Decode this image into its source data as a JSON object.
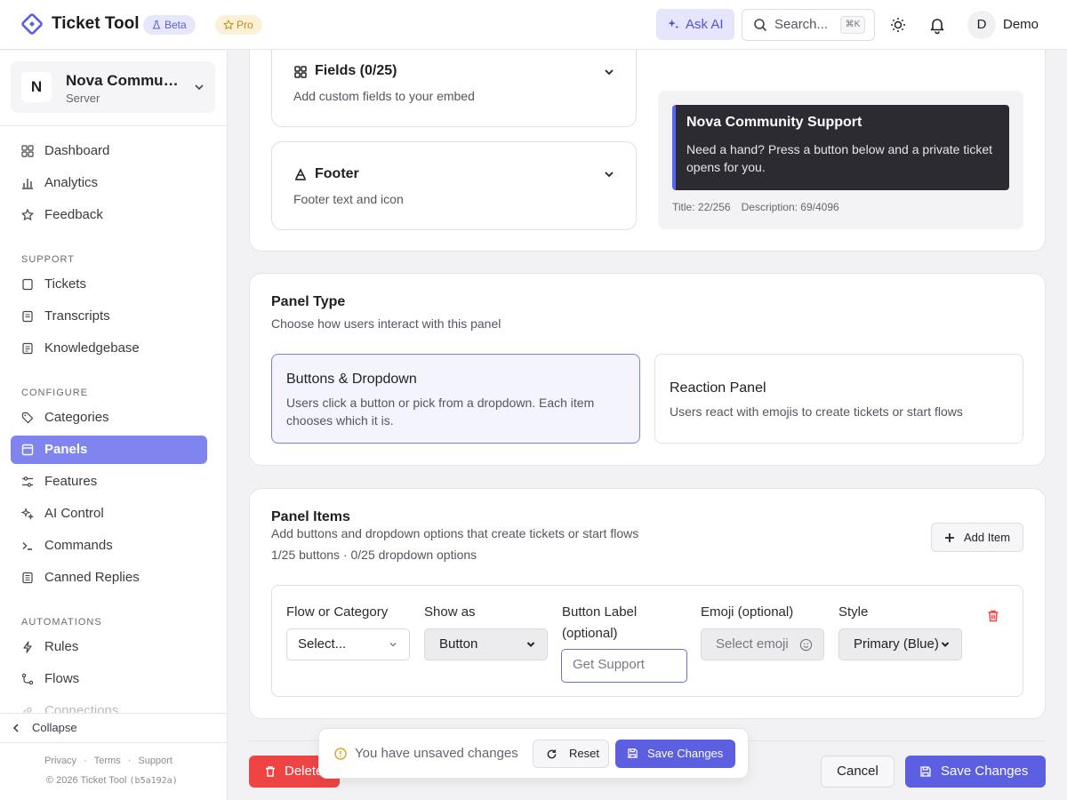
{
  "app": {
    "title": "Ticket Tool",
    "badges": {
      "beta": "Beta",
      "pro": "Pro"
    },
    "brand_color": "#5b5fe0"
  },
  "topbar": {
    "ask_ai_label": "Ask AI",
    "search_placeholder": "Search...",
    "search_shortcut": "⌘K",
    "user": {
      "initial": "D",
      "name": "Demo"
    }
  },
  "sidebar": {
    "server": {
      "initial": "N",
      "name": "Nova Community Support",
      "type": "Server"
    },
    "items_top": [
      {
        "label": "Dashboard",
        "icon": "dashboard-icon"
      },
      {
        "label": "Analytics",
        "icon": "bar-chart-icon"
      },
      {
        "label": "Feedback",
        "icon": "star-icon"
      }
    ],
    "sections": [
      {
        "title": "SUPPORT",
        "items": [
          {
            "label": "Tickets",
            "icon": "ticket-icon"
          },
          {
            "label": "Transcripts",
            "icon": "document-icon"
          },
          {
            "label": "Knowledgebase",
            "icon": "book-icon"
          }
        ]
      },
      {
        "title": "CONFIGURE",
        "items": [
          {
            "label": "Categories",
            "icon": "tag-icon"
          },
          {
            "label": "Panels",
            "icon": "panel-icon",
            "active": true
          },
          {
            "label": "Features",
            "icon": "sliders-icon"
          },
          {
            "label": "AI Control",
            "icon": "sparkles-icon"
          },
          {
            "label": "Commands",
            "icon": "terminal-icon"
          },
          {
            "label": "Canned Replies",
            "icon": "reply-icon"
          }
        ]
      },
      {
        "title": "AUTOMATIONS",
        "items": [
          {
            "label": "Rules",
            "icon": "bolt-icon"
          },
          {
            "label": "Flows",
            "icon": "flow-icon"
          },
          {
            "label": "Connections",
            "icon": "link-icon"
          }
        ]
      }
    ],
    "collapse_label": "Collapse",
    "footer_links": [
      "Privacy",
      "Terms",
      "Support"
    ],
    "copyright": "© 2026 Ticket Tool",
    "build": "(b5a192a)"
  },
  "embed_editor": {
    "fields": {
      "title": "Fields (0/25)",
      "desc": "Add custom fields to your embed"
    },
    "footer": {
      "title": "Footer",
      "desc": "Footer text and icon"
    },
    "preview": {
      "title": "Nova Community Support",
      "description": "Need a hand? Press a button below and a private ticket opens for you.",
      "accent_color": "#5865f2",
      "title_count": "Title: 22/256",
      "desc_count": "Description: 69/4096"
    }
  },
  "panel_type": {
    "title": "Panel Type",
    "subtitle": "Choose how users interact with this panel",
    "options": [
      {
        "title": "Buttons & Dropdown",
        "desc": "Users click a button or pick from a dropdown. Each item chooses which it is.",
        "selected": true
      },
      {
        "title": "Reaction Panel",
        "desc": "Users react with emojis to create tickets or start flows",
        "selected": false
      }
    ]
  },
  "panel_items": {
    "title": "Panel Items",
    "subtitle": "Add buttons and dropdown options that create tickets or start flows",
    "counts": "1/25 buttons · 0/25 dropdown options",
    "add_label": "Add Item",
    "row": {
      "flow_label": "Flow or Category",
      "flow_value": "Select...",
      "show_as_label": "Show as",
      "show_as_value": "Button",
      "button_label_label": "Button Label (optional)",
      "button_label_placeholder": "Get Support",
      "emoji_label": "Emoji (optional)",
      "emoji_placeholder": "Select emoji",
      "style_label": "Style",
      "style_value": "Primary (Blue)"
    }
  },
  "bottom": {
    "delete_label": "Delete",
    "cancel_label": "Cancel",
    "save_label": "Save Changes",
    "unsaved_message": "You have unsaved changes",
    "reset_label": "Reset",
    "unsaved_save_label": "Save Changes"
  }
}
